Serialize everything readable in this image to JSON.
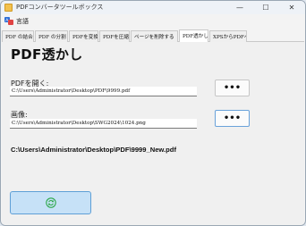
{
  "window": {
    "title": "PDFコンバータツールボックス",
    "minimize_glyph": "—",
    "maximize_glyph": "☐",
    "close_glyph": "✕"
  },
  "menu": {
    "language_label": "言語"
  },
  "tabs": [
    {
      "label": "PDF の結合",
      "active": false
    },
    {
      "label": "PDF の分割",
      "active": false
    },
    {
      "label": "PDFを変換",
      "active": false
    },
    {
      "label": "PDFを圧縮",
      "active": false
    },
    {
      "label": "ページを削除する",
      "active": false
    },
    {
      "label": "PDF透かし",
      "active": true
    },
    {
      "label": "XPSからPDFへ",
      "active": false
    }
  ],
  "main": {
    "page_title": "PDF透かし",
    "pdf_open_label": "PDFを開く:",
    "pdf_path_value": "C:\\Users\\Administrator\\Desktop\\PDF\\9999.pdf",
    "image_label": "画像:",
    "image_path_value": "C:\\Users\\Administrator\\Desktop\\SWG2024\\1024.png",
    "browse_label": "•••",
    "output_path": "C:\\Users\\Administrator\\Desktop\\PDF\\9999_New.pdf"
  },
  "colors": {
    "run_button_bg": "#c6e1f7",
    "run_button_border": "#5e9fd6",
    "run_icon": "#2ca84a"
  },
  "icons": {
    "run_button_icon": "refresh-circle-icon"
  }
}
